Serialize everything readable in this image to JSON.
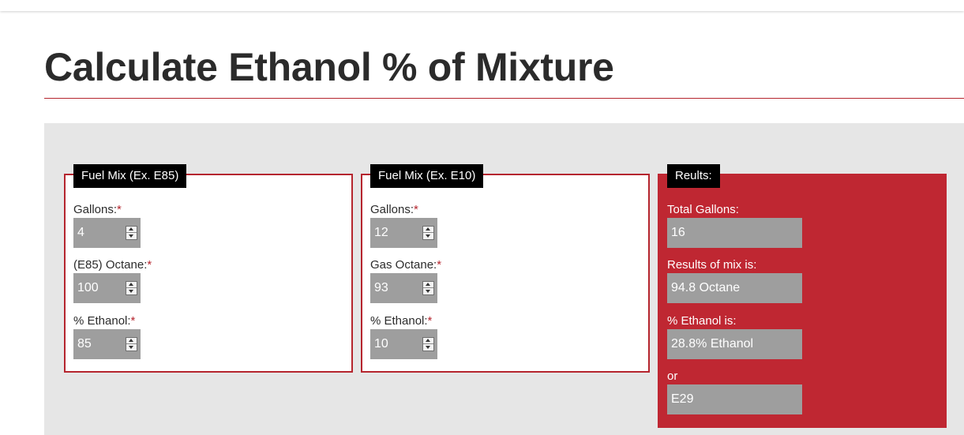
{
  "page": {
    "title": "Calculate Ethanol % of Mixture"
  },
  "colors": {
    "accent": "#b5252e",
    "results_bg": "#bf2732",
    "legend_bg": "#000000",
    "calc_bg": "#e6e6e6",
    "field_bg": "#9e9e9e"
  },
  "required_marker": "*",
  "mix1": {
    "legend": "Fuel Mix (Ex. E85)",
    "gallons_label": "Gallons:",
    "gallons_value": "4",
    "octane_label": "(E85) Octane:",
    "octane_value": "100",
    "ethanol_label": "% Ethanol:",
    "ethanol_value": "85"
  },
  "mix2": {
    "legend": "Fuel Mix (Ex. E10)",
    "gallons_label": "Gallons:",
    "gallons_value": "12",
    "octane_label": "Gas Octane:",
    "octane_value": "93",
    "ethanol_label": "% Ethanol:",
    "ethanol_value": "10"
  },
  "results": {
    "legend": "Reults:",
    "total_label": "Total Gallons:",
    "total_value": "16",
    "mix_label": "Results of mix is:",
    "mix_value": "94.8 Octane",
    "ethanol_label": "% Ethanol is:",
    "ethanol_value": "28.8% Ethanol",
    "or_label": "or",
    "e_value": "E29"
  }
}
